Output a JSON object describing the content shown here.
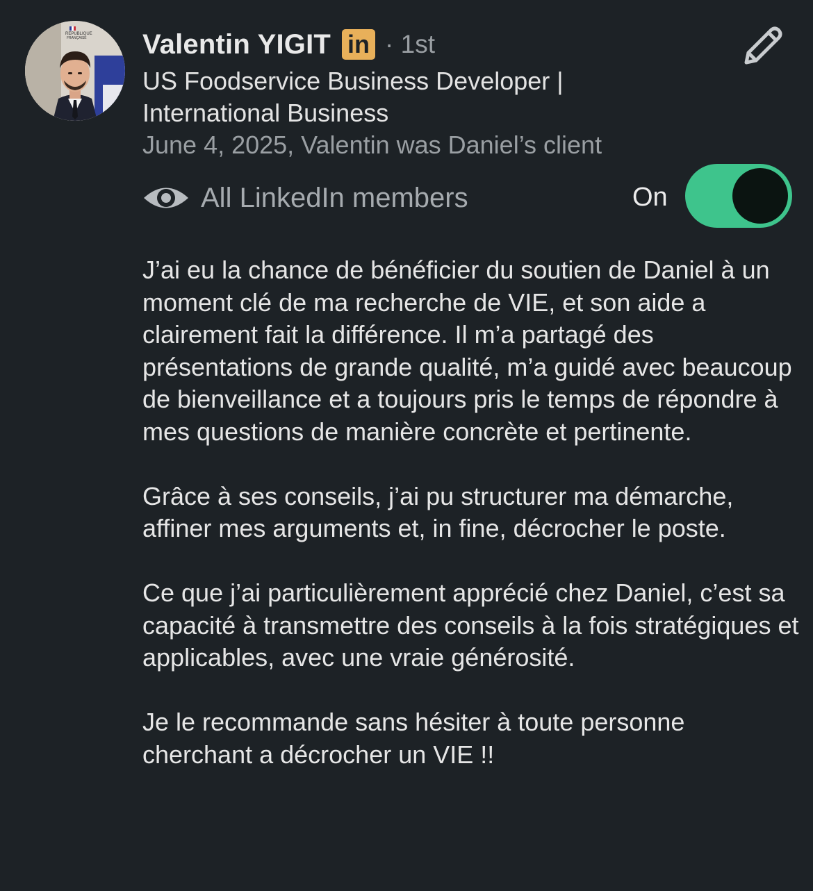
{
  "profile": {
    "name": "Valentin YIGIT",
    "badge_text": "in",
    "degree": "· 1st",
    "headline": "US Foodservice Business Developer | International Business",
    "relation": "June 4, 2025, Valentin was Daniel’s client",
    "avatar_icon": "profile-photo",
    "avatar_backdrop_text": "RÉPUBLIQUE FRANÇAISE"
  },
  "actions": {
    "edit_icon": "pencil-icon"
  },
  "visibility": {
    "icon": "eye-icon",
    "label": "All LinkedIn members",
    "toggle_state": "On",
    "toggle_on": true,
    "toggle_color": "#3ec48c"
  },
  "recommendation": {
    "paragraphs": [
      "J’ai eu la chance de bénéficier du soutien de Daniel à un moment clé de ma recherche de VIE, et son aide a clairement fait la différence. Il m’a partagé des présentations de grande qualité, m’a guidé avec beaucoup de bienveillance et a toujours pris le temps de répondre à mes questions de manière concrète et pertinente.",
      "Grâce à ses conseils, j’ai pu structurer ma démarche, affiner mes arguments et, in fine, décrocher le poste.",
      "Ce que j’ai particulièrement apprécié chez Daniel, c’est sa capacité à transmettre des conseils à la fois stratégiques et applicables, avec une vraie générosité.",
      "Je le recommande sans hésiter à toute personne cherchant a décrocher un VIE !!"
    ]
  },
  "colors": {
    "background": "#1d2226",
    "badge": "#e8b05a",
    "muted_text": "#9a9fa3",
    "primary_text": "#e6e6e6"
  }
}
